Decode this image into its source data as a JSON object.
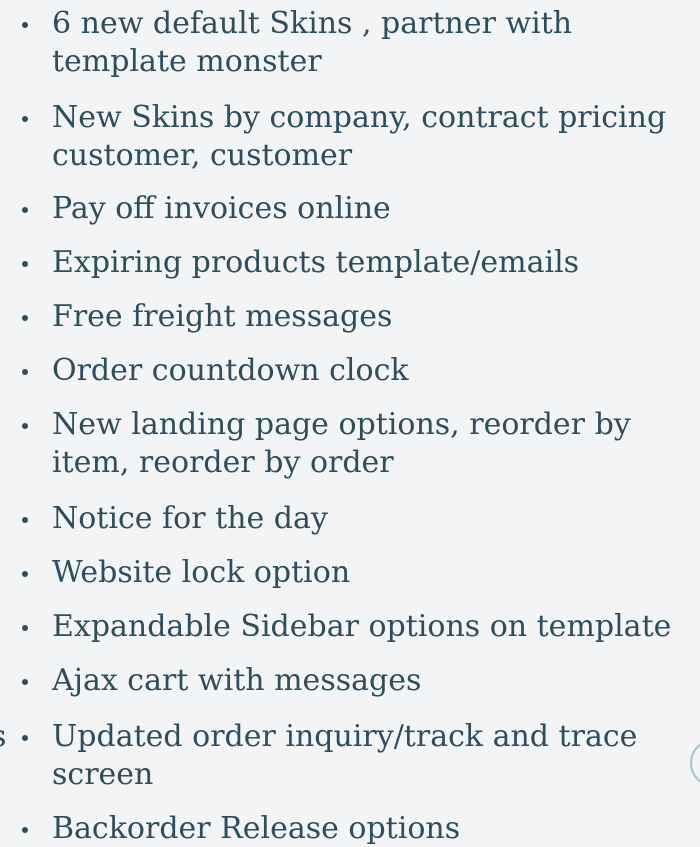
{
  "bullets": [
    {
      "lines": [
        "6 new default Skins , partner with",
        "template monster"
      ]
    },
    {
      "lines": [
        "New Skins by company, contract pricing",
        "customer, customer"
      ]
    },
    {
      "lines": [
        "Pay off invoices online"
      ]
    },
    {
      "lines": [
        "Expiring products template/emails"
      ]
    },
    {
      "lines": [
        "Free freight messages"
      ]
    },
    {
      "lines": [
        "Order countdown clock"
      ]
    },
    {
      "lines": [
        "New landing page options, reorder by",
        "item, reorder by order"
      ]
    },
    {
      "lines": [
        "Notice for the day"
      ]
    },
    {
      "lines": [
        "Website lock option"
      ]
    },
    {
      "lines": [
        "Expandable Sidebar options on template"
      ]
    },
    {
      "lines": [
        "Ajax cart with messages"
      ]
    },
    {
      "lines": [
        "Updated order inquiry/track and trace",
        "screen"
      ]
    },
    {
      "lines": [
        "Backorder Release options"
      ]
    }
  ],
  "edge_fragment_text": "s",
  "colors": {
    "text": "#2e4d5e",
    "background": "#f3f4f5",
    "accent_circle": "#9fc9c8"
  }
}
